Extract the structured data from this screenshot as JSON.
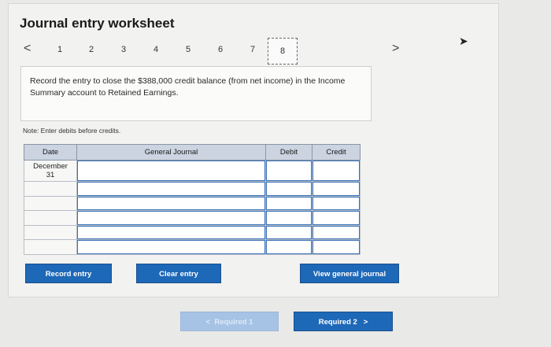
{
  "worksheet": {
    "title": "Journal entry worksheet"
  },
  "steps": {
    "prev_label": "<",
    "next_label": ">",
    "items": [
      "1",
      "2",
      "3",
      "4",
      "5",
      "6",
      "7",
      "8"
    ],
    "active": "8"
  },
  "instruction": "Record the entry to close the $388,000 credit balance (from net income) in the Income Summary account to Retained Earnings.",
  "note": "Note: Enter debits before credits.",
  "journal": {
    "headers": {
      "date": "Date",
      "account": "General Journal",
      "debit": "Debit",
      "credit": "Credit"
    },
    "date_value": "December\n31",
    "rows": 6
  },
  "buttons": {
    "record": "Record entry",
    "clear": "Clear entry",
    "view": "View general journal",
    "required1": "Required 1",
    "required2": "Required 2",
    "prev_arrow": "<",
    "next_arrow": ">"
  },
  "colors": {
    "button": "#1e68b8",
    "header": "#cbd4e0",
    "input_border": "#3a72b8"
  }
}
